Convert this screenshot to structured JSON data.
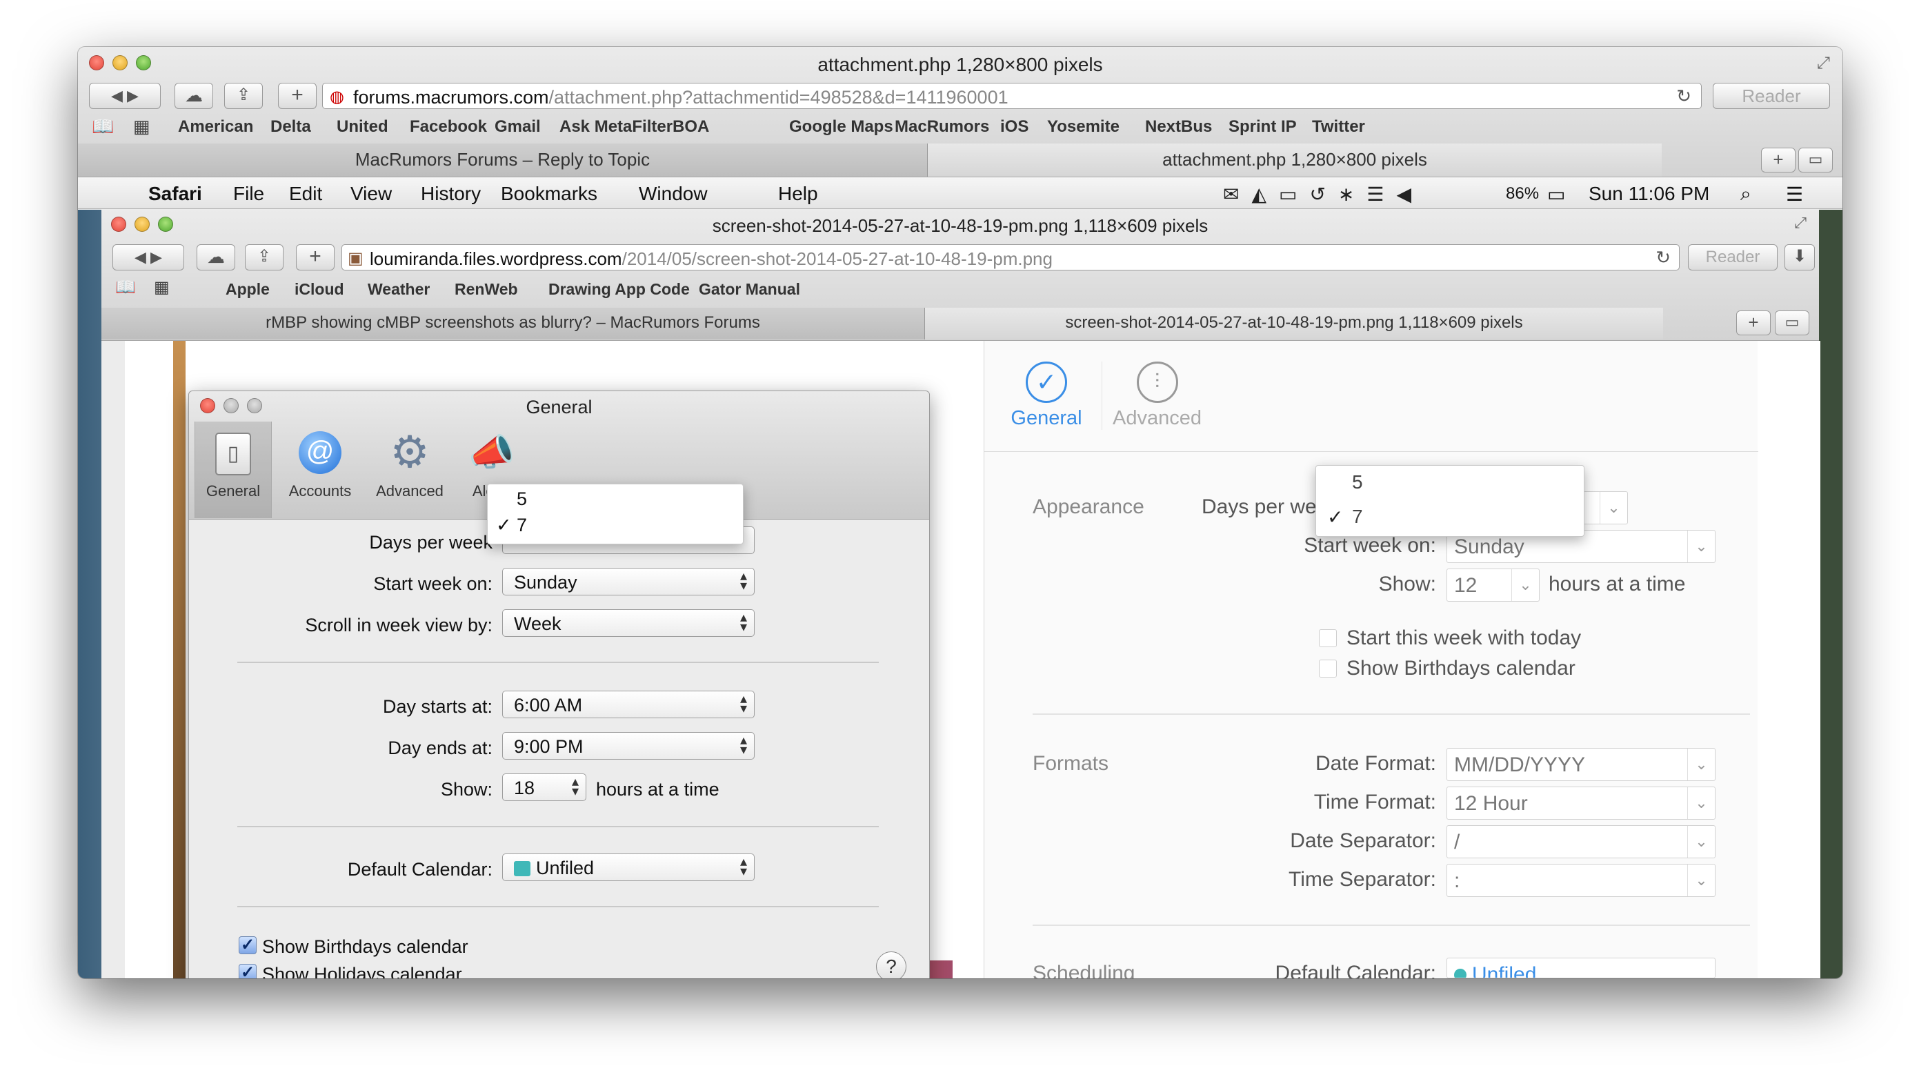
{
  "outer": {
    "title": "attachment.php 1,280×800 pixels",
    "url_domain": "forums.macrumors.com",
    "url_path": "/attachment.php?attachmentid=498528&d=1411960001",
    "reader": "Reader",
    "bookmarks": [
      "American",
      "Delta",
      "United",
      "Facebook",
      "Gmail",
      "Ask MetaFilter",
      "BOA",
      "Google Maps",
      "MacRumors",
      "iOS",
      "Yosemite",
      "NextBus",
      "Sprint IP",
      "Twitter"
    ],
    "tabs": [
      "MacRumors Forums – Reply to Topic",
      "attachment.php 1,280×800 pixels"
    ]
  },
  "menubar": {
    "app": "Safari",
    "items": [
      "File",
      "Edit",
      "View",
      "History",
      "Bookmarks",
      "Window",
      "Help"
    ],
    "battery": "86%",
    "clock": "Sun 11:06 PM"
  },
  "inner": {
    "title": "screen-shot-2014-05-27-at-10-48-19-pm.png 1,118×609 pixels",
    "url_domain": "loumiranda.files.wordpress.com",
    "url_path": "/2014/05/screen-shot-2014-05-27-at-10-48-19-pm.png",
    "reader": "Reader",
    "bookmarks": [
      "Apple",
      "iCloud",
      "Weather",
      "RenWeb",
      "Drawing App Code",
      "Gator Manual"
    ],
    "tabs": [
      "rMBP showing cMBP screenshots as blurry? – MacRumors Forums",
      "screen-shot-2014-05-27-at-10-48-19-pm.png 1,118×609 pixels"
    ]
  },
  "prefs": {
    "title": "General",
    "toolbar": [
      "General",
      "Accounts",
      "Advanced",
      "Alerts"
    ],
    "popup": [
      "5",
      "7"
    ],
    "popup_checked": "✓",
    "days_per_week_label": "Days per week",
    "start_week_label": "Start week on:",
    "start_week_value": "Sunday",
    "scroll_label": "Scroll in week view by:",
    "scroll_value": "Week",
    "day_starts_label": "Day starts at:",
    "day_starts_value": "6:00 AM",
    "day_ends_label": "Day ends at:",
    "day_ends_value": "9:00 PM",
    "show_label": "Show:",
    "show_value": "18",
    "hours_label": "hours at a time",
    "default_cal_label": "Default Calendar:",
    "default_cal_value": "Unfiled",
    "check_birthdays": "Show Birthdays calendar",
    "check_holidays": "Show Holidays calendar",
    "help": "?"
  },
  "right": {
    "toolbar": [
      "General",
      "Advanced"
    ],
    "appearance": "Appearance",
    "days_per_week_label": "Days per we",
    "popup": [
      "5",
      "7"
    ],
    "popup_checked": "✓",
    "start_week_label": "Start week on:",
    "start_week_value": "Sunday",
    "show_label": "Show:",
    "show_value": "12",
    "hours_label": "hours at a time",
    "check_today": "Start this week with today",
    "check_birthdays": "Show Birthdays calendar",
    "formats": "Formats",
    "date_format_label": "Date Format:",
    "date_format_value": "MM/DD/YYYY",
    "time_format_label": "Time Format:",
    "time_format_value": "12 Hour",
    "date_sep_label": "Date Separator:",
    "date_sep_value": "/",
    "time_sep_label": "Time Separator:",
    "time_sep_value": ":",
    "scheduling": "Scheduling",
    "default_cal_label": "Default Calendar:",
    "default_cal_value": "Unfiled"
  },
  "colors": {
    "accent": "#3a8ee6",
    "unfiled": "#3fb8b8"
  }
}
